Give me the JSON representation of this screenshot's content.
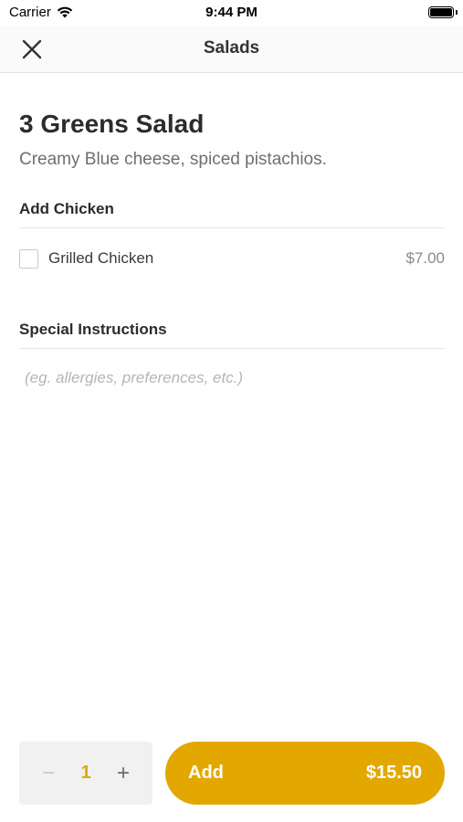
{
  "status_bar": {
    "carrier": "Carrier",
    "time": "9:44 PM"
  },
  "nav": {
    "title": "Salads",
    "close_icon": "close-icon"
  },
  "item": {
    "title": "3 Greens Salad",
    "description": "Creamy Blue cheese, spiced pistachios."
  },
  "add_chicken": {
    "header": "Add Chicken",
    "options": [
      {
        "label": "Grilled Chicken",
        "price": "$7.00",
        "checked": false
      }
    ]
  },
  "special_instructions": {
    "header": "Special Instructions",
    "placeholder": "(eg. allergies, preferences, etc.)",
    "value": ""
  },
  "footer": {
    "quantity": "1",
    "minus": "−",
    "plus": "+",
    "add_label": "Add",
    "total": "$15.50"
  },
  "colors": {
    "accent": "#e2a800",
    "quantity": "#e0a800"
  }
}
